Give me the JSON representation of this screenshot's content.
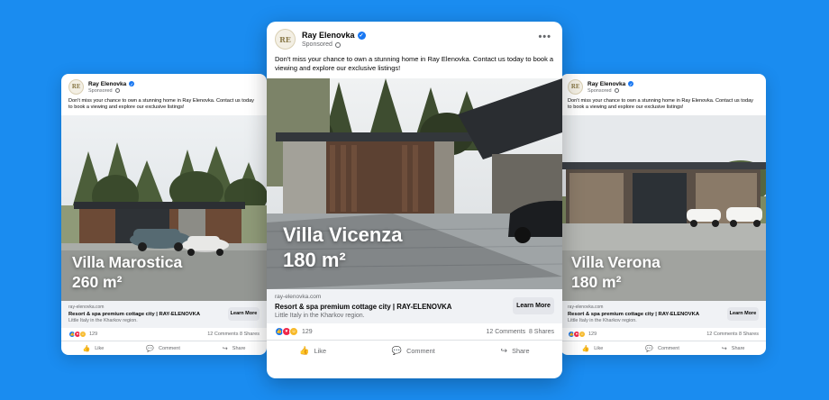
{
  "colors": {
    "background": "#1a8cf0",
    "verified": "#1877f2"
  },
  "icons": {
    "verified": "verified-badge-icon",
    "audience": "globe-icon",
    "more": "more-options-icon",
    "like": "thumbs-up-icon",
    "comment": "comment-icon",
    "share": "share-icon"
  },
  "post": {
    "page_name": "Ray Elenovka",
    "sponsored": "Sponsored",
    "caption": "Don't miss your chance to own a stunning home in Ray Elenovka. Contact us today to book a viewing and explore our exclusive listings!",
    "link_domain": "ray-elenovka.com",
    "link_title": "Resort & spa premium cottage city | RAY-ELENOVKA",
    "link_description": "Little Italy in the Kharkov region.",
    "cta": "Learn More",
    "reaction_count": "129",
    "comments": "12 Comments",
    "shares": "8 Shares",
    "actions": {
      "like": "Like",
      "comment": "Comment",
      "share": "Share"
    }
  },
  "left": {
    "villa_name": "Villa Marostica",
    "area": "260 m²"
  },
  "center": {
    "villa_name": "Villa Vicenza",
    "area": "180 m²"
  },
  "right": {
    "villa_name": "Villa Verona",
    "area": "180 m²"
  }
}
